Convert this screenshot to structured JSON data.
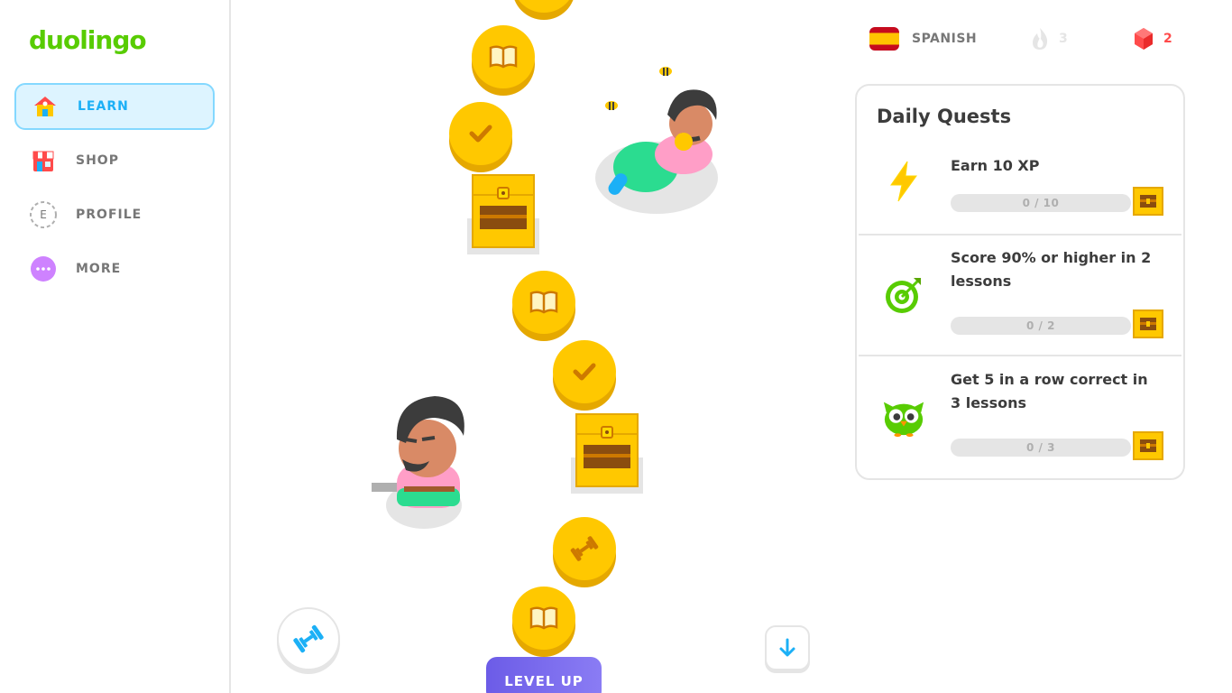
{
  "brand": {
    "logo_text": "duolingo",
    "accent": "#58cc02",
    "blue": "#1cb0f6",
    "gold": "#ffc800"
  },
  "sidebar": {
    "items": [
      {
        "label": "LEARN",
        "icon": "house-icon",
        "active": true
      },
      {
        "label": "SHOP",
        "icon": "shop-icon",
        "active": false
      },
      {
        "label": "PROFILE",
        "icon": "profile-icon",
        "avatar_letter": "E",
        "active": false
      },
      {
        "label": "MORE",
        "icon": "more-icon",
        "active": false
      }
    ]
  },
  "path": {
    "nodes": [
      {
        "type": "lesson",
        "icon": "book-icon",
        "state": "completed"
      },
      {
        "type": "lesson",
        "icon": "check-icon",
        "state": "completed"
      },
      {
        "type": "chest",
        "icon": "treasure-chest-icon",
        "state": "opened"
      },
      {
        "type": "lesson",
        "icon": "book-icon",
        "state": "completed"
      },
      {
        "type": "lesson",
        "icon": "check-icon",
        "state": "completed"
      },
      {
        "type": "chest",
        "icon": "treasure-chest-icon",
        "state": "opened"
      },
      {
        "type": "practice",
        "icon": "dumbbell-icon",
        "state": "completed"
      },
      {
        "type": "lesson",
        "icon": "book-icon",
        "state": "completed"
      }
    ],
    "practice_button_icon": "dumbbell-icon",
    "scroll_button_icon": "arrow-down-icon",
    "level_up_label": "LEVEL UP"
  },
  "topbar": {
    "language": "SPANISH",
    "flag_icon": "spain-flag-icon",
    "streak": "3",
    "gems": "2"
  },
  "daily_quests": {
    "title": "Daily Quests",
    "items": [
      {
        "title": "Earn 10 XP",
        "icon": "lightning-icon",
        "progress_text": "0 / 10",
        "progress": 0
      },
      {
        "title": "Score 90% or higher in 2 lessons",
        "icon": "target-icon",
        "progress_text": "0 / 2",
        "progress": 0
      },
      {
        "title": "Get 5 in a row correct in 3 lessons",
        "icon": "owl-icon",
        "progress_text": "0 / 3",
        "progress": 0
      }
    ]
  }
}
